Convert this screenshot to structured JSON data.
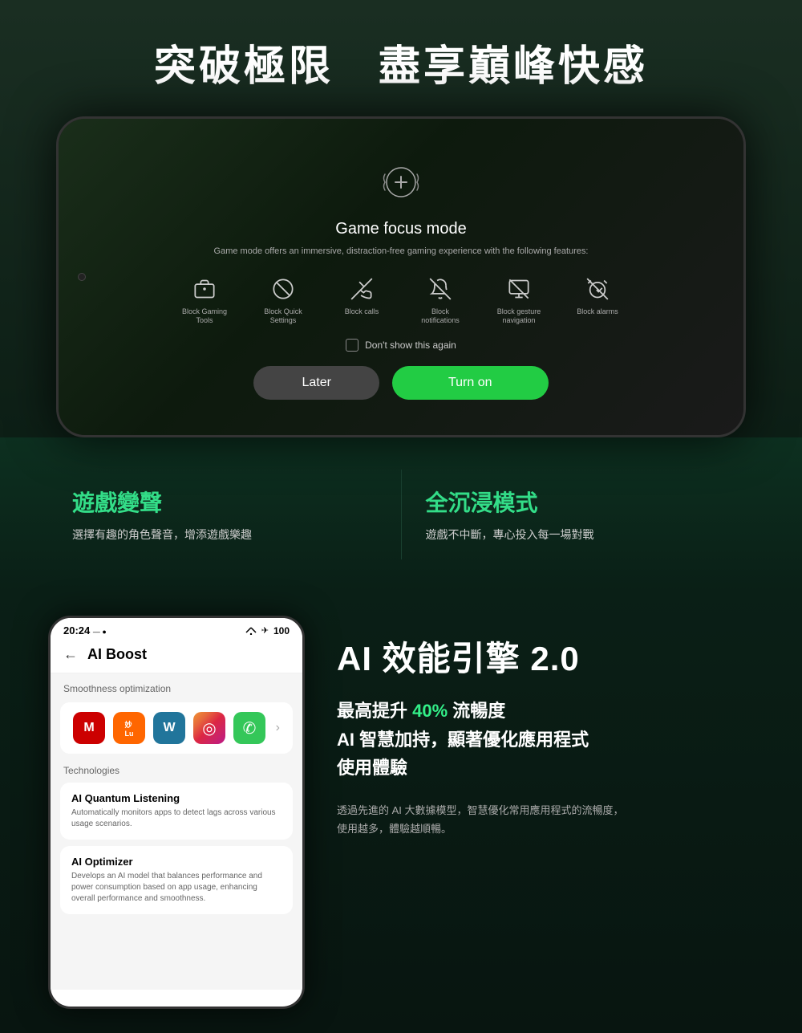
{
  "headline": "突破極限　盡享巔峰快感",
  "phone1": {
    "modal": {
      "title": "Game focus mode",
      "description": "Game mode offers an immersive, distraction-free gaming experience with the following features:",
      "features": [
        {
          "label": "Block Gaming\nTools",
          "icon": "briefcase"
        },
        {
          "label": "Block Quick\nSettings",
          "icon": "slash-circle"
        },
        {
          "label": "Block calls",
          "icon": "phone-off"
        },
        {
          "label": "Block\nnotifications",
          "icon": "bell-off"
        },
        {
          "label": "Block gesture\nnavigation",
          "icon": "gesture-off"
        },
        {
          "label": "Block alarms",
          "icon": "alarm-off"
        }
      ],
      "dont_show_label": "Don't show this again",
      "btn_later": "Later",
      "btn_turn_on": "Turn on"
    }
  },
  "features": [
    {
      "title": "遊戲變聲",
      "desc": "選擇有趣的角色聲音，增添遊戲樂趣"
    },
    {
      "title": "全沉浸模式",
      "desc": "遊戲不中斷，專心投入每一場對戰"
    }
  ],
  "phone2": {
    "status_time": "20:24",
    "status_extra": "— ●",
    "status_icons": "⊙ ✈ 100",
    "header_back": "←",
    "header_title": "AI Boost",
    "smoothness_label": "Smoothness optimization",
    "apps": [
      "M",
      "妙",
      "W",
      "📷",
      "☎"
    ],
    "technologies_label": "Technologies",
    "tech_cards": [
      {
        "title": "AI Quantum Listening",
        "desc": "Automatically monitors apps to detect lags across various usage scenarios."
      },
      {
        "title": "AI Optimizer",
        "desc": "Develops an AI model that balances performance and power consumption based on app usage, enhancing overall performance and smoothness."
      }
    ]
  },
  "info": {
    "title": "AI 效能引擎 2.0",
    "highlights": [
      "最高提升 40% 流暢度",
      "AI 智慧加持，顯著優化應用程式",
      "使用體驗"
    ],
    "desc_lines": [
      "透過先進的 AI 大數據模型，智慧優化常用應用程式的流暢度，",
      "使用越多，體驗越順暢。"
    ]
  }
}
